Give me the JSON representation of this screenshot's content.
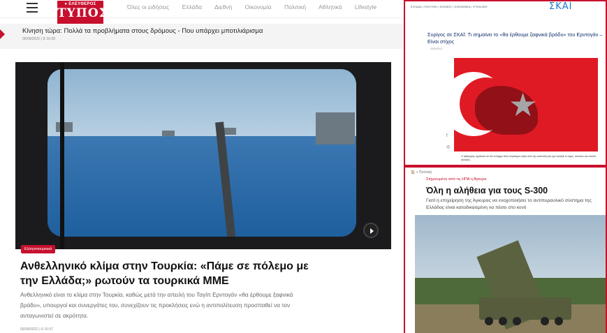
{
  "left": {
    "logo": {
      "line1": "● ΕΛΕΥΘΕΡΟΣ",
      "line2": "ΤΥΠΟΣ"
    },
    "nav": [
      "Όλες οι ειδήσεις",
      "Ελλάδα",
      "Διεθνή",
      "Οικονομία",
      "Πολιτική",
      "Αθλητικά",
      "Lifestyle"
    ],
    "ticker": {
      "title": "Κίνηση τώρα: Πολλά τα προβλήματα στους δρόμους - Που υπάρχει μποτιλιάρισμα",
      "meta": "05/09/2022 | ⏱ 16:39"
    },
    "hero": {
      "badge": "Ελληνοτουρκικά"
    },
    "headline": "Ανθελληνικό κλίμα στην Τουρκία: «Πάμε σε πόλεμο με την Ελλάδα;» ρωτούν τα τουρκικά ΜΜΕ",
    "summary": "Ανθελληνικό είναι το κλίμα στην Τουρκία, καθώς μετά την απειλή του Ταγίπ Ερντογάν «θα έρθουμε ξαφνικά βράδυ», υπουργοί και συνεργάτες του, συνεχίζουν τις προκλήσεις ενώ η αντιπολίτευση προσπαθεί να τον ανταγωνιστεί σε ακρότητα.",
    "date": "05/09/2022 | ⏱ 10:37"
  },
  "right_top": {
    "nav": "ΕΛΛΑΔΑ | ΠΟΛΙΤΙΚΗ | ΚΟΣΜΟΣ | ΟΙΚΟΝΟΜΙΑ | ΥΓΕΙΑ/ΖΩΗ",
    "brand": "ΣΚΑΪ",
    "title": "Συρίγος σε ΣΚΑΪ: Τι σημαίνει το «θα έρθουμε ξαφνικά βράδυ» του Ερντογάν – Είναι στίχος",
    "date": "05/09/2022",
    "caption": "Ο καθηγητής σχολίασε ότι δεν υπάρχει άλλο περιθώριο πέρα από την αναστολή και έχει αλλάξει το ύφος, απειλών και πολλές εξελίξεις."
  },
  "right_bottom": {
    "crumb": "🏠 > Πολιτική",
    "kicker": "Στημοωμένη από τις ΗΠΑ η Άγκυρα",
    "headline": "Όλη η αλήθεια για τους S-300",
    "sub": "Γιατί η επιχείρηση της Άγκυρας να ενοχοποιήσει το αντιπυραυλικό σύστημα της Ελλάδας είναι καταδικασμένη να πέσει στο κενό"
  }
}
